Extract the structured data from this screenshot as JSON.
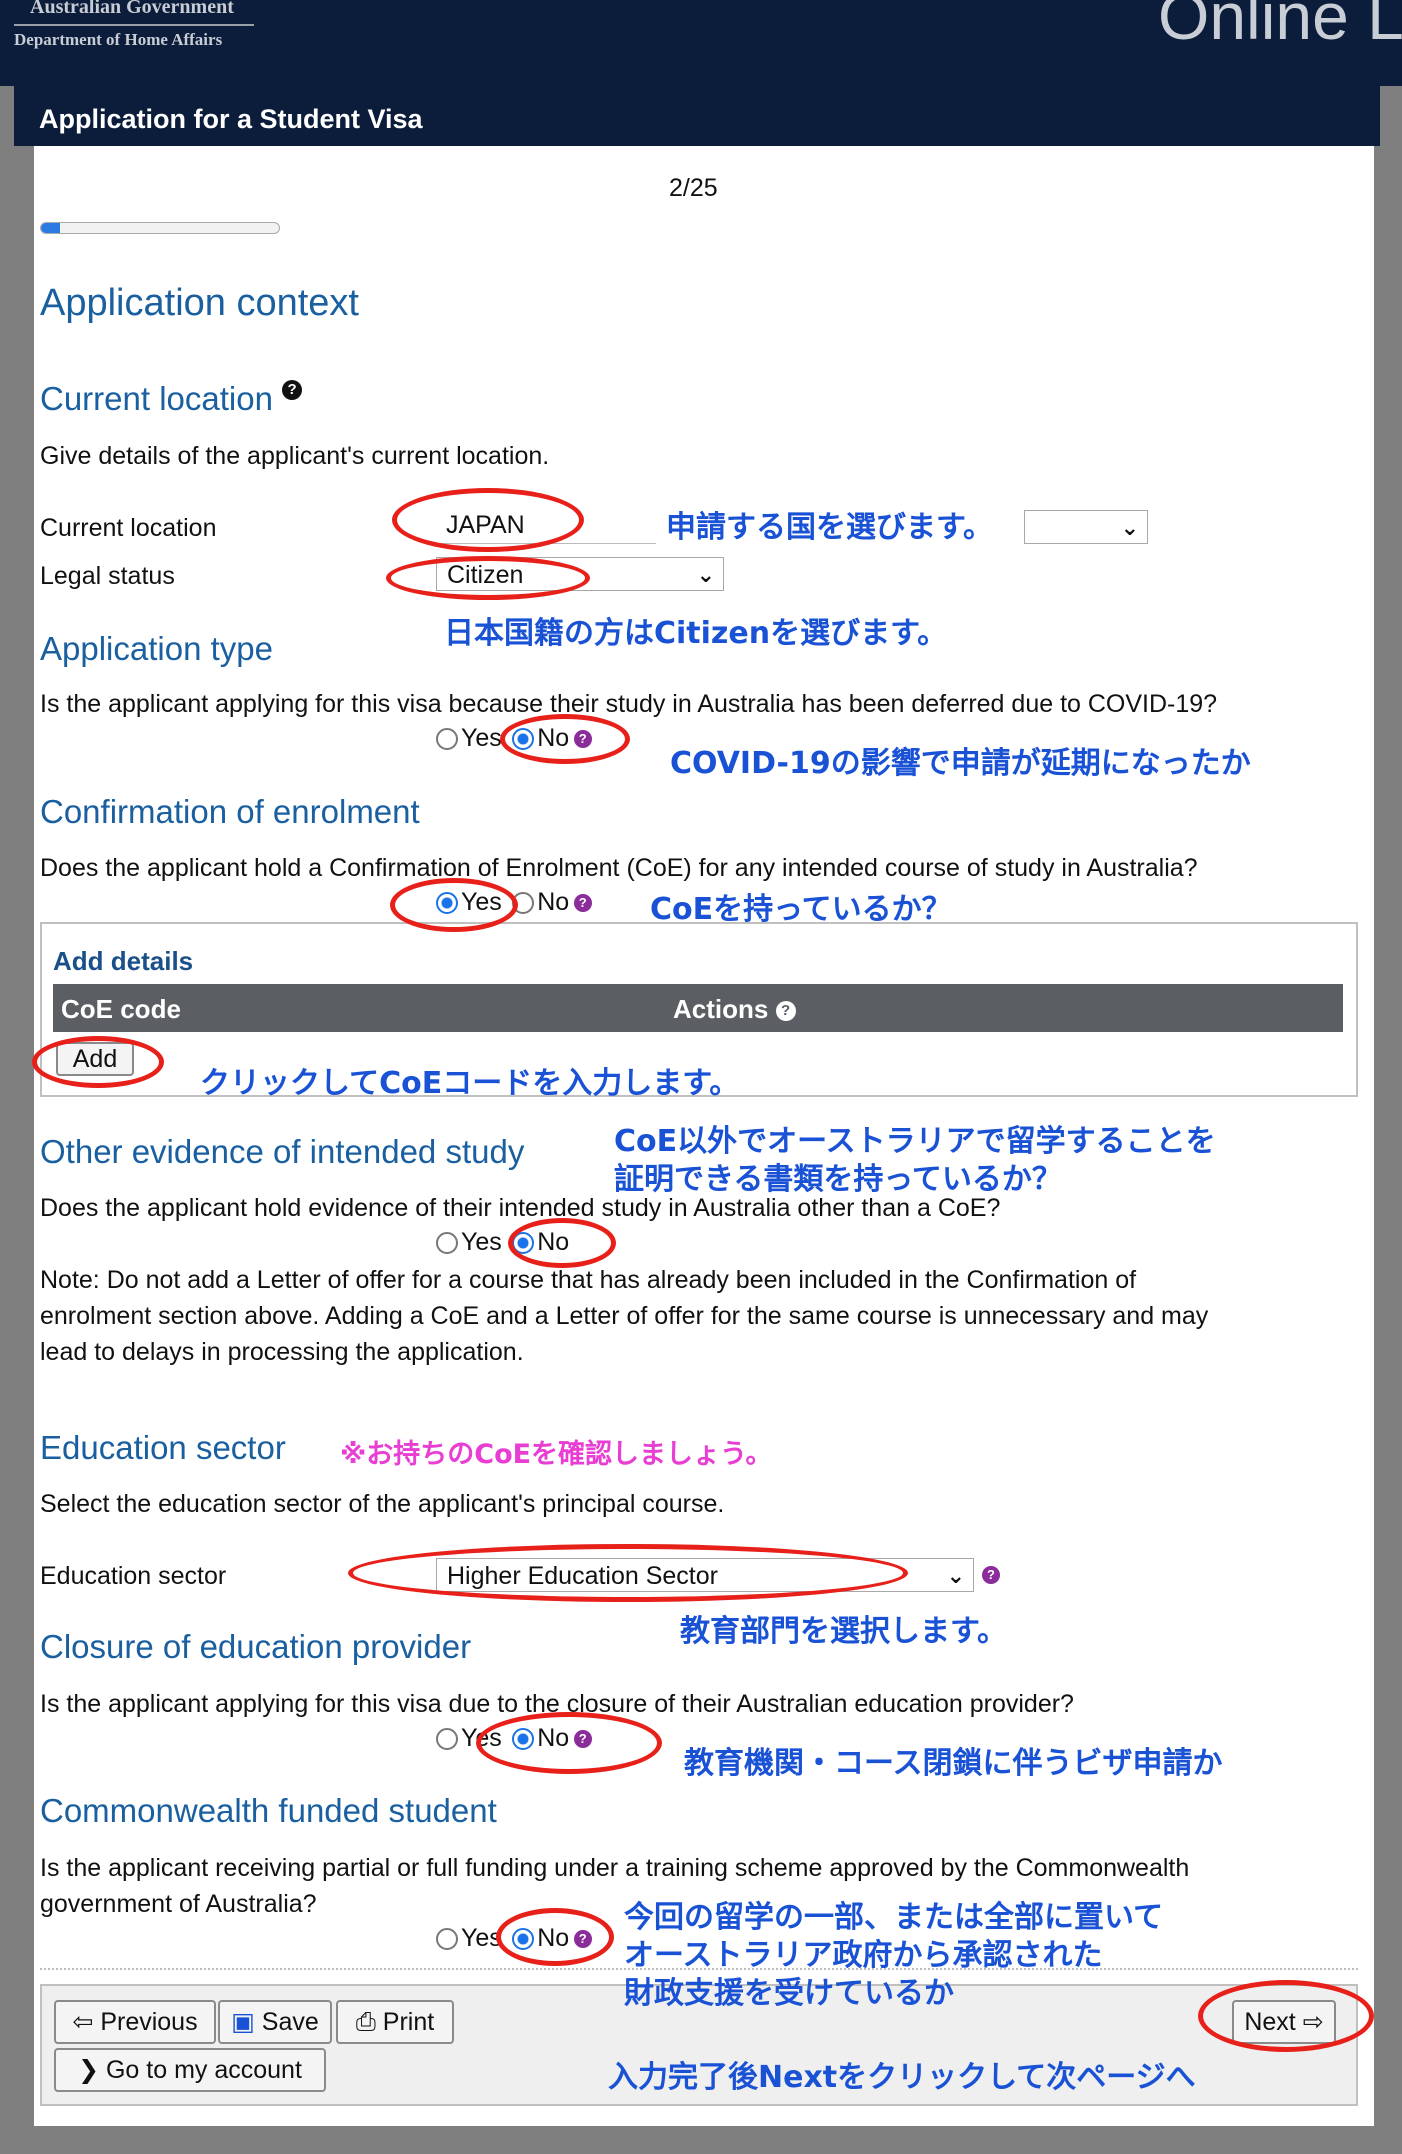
{
  "header": {
    "gov_line1": "Australian Government",
    "gov_line2": "Department of Home Affairs",
    "site_title": "Online L",
    "page_title": "Application for a Student Visa"
  },
  "progress": {
    "page_label": "2/25",
    "fraction": 0.08
  },
  "main_heading": "Application context",
  "sections": {
    "current_location": {
      "heading": "Current location",
      "description": "Give details of the applicant's current location.",
      "location_label": "Current location",
      "location_value": "JAPAN",
      "legal_status_label": "Legal status",
      "legal_status_value": "Citizen"
    },
    "application_type": {
      "heading": "Application type",
      "question": "Is the applicant applying for this visa because their study in Australia has been deferred due to COVID-19?",
      "yes": "Yes",
      "no": "No",
      "selected": "No"
    },
    "coe": {
      "heading": "Confirmation of enrolment",
      "question": "Does the applicant hold a Confirmation of Enrolment (CoE) for any intended course of study in Australia?",
      "yes": "Yes",
      "no": "No",
      "selected": "Yes",
      "add_details": "Add details",
      "col_code": "CoE code",
      "col_actions": "Actions",
      "add_button": "Add"
    },
    "other_evidence": {
      "heading": "Other evidence of intended study",
      "question": "Does the applicant hold evidence of their intended study in Australia other than a CoE?",
      "yes": "Yes",
      "no": "No",
      "selected": "No",
      "note_line1": "Note: Do not add a Letter of offer for a course that has already been included in the Confirmation of",
      "note_line2": "enrolment section above. Adding a CoE and a Letter of offer for the same course is unnecessary and may",
      "note_line3": "lead to delays in processing the application."
    },
    "education_sector": {
      "heading": "Education sector",
      "description": "Select the education sector of the applicant's principal course.",
      "label": "Education sector",
      "value": "Higher Education Sector"
    },
    "closure": {
      "heading": "Closure of education provider",
      "question": "Is the applicant applying for this visa due to the closure of their Australian education provider?",
      "yes": "Yes",
      "no": "No",
      "selected": "No"
    },
    "commonwealth": {
      "heading": "Commonwealth funded student",
      "question_line1": "Is the applicant receiving partial or full funding under a training scheme approved by the Commonwealth",
      "question_line2": "government of Australia?",
      "yes": "Yes",
      "no": "No",
      "selected": "No"
    }
  },
  "footer": {
    "previous": "Previous",
    "save": "Save",
    "print": "Print",
    "account": "Go to my account",
    "next": "Next"
  },
  "annotations": {
    "country": "申請する国を選びます。",
    "citizen": "日本国籍の方はCitizenを選びます。",
    "covid": "COVID-19の影響で申請が延期になったか",
    "coe": "CoEを持っているか？",
    "add": "クリックしてCoEコードを入力します。",
    "evidence_line1": "CoE以外でオーストラリアで留学することを",
    "evidence_line2": "証明できる書類を持っているか？",
    "sector_note": "※お持ちのCoEを確認しましょう。",
    "sector": "教育部門を選択します。",
    "closure": "教育機関・コース閉鎖に伴うビザ申請か",
    "funding_line1": "今回の留学の一部、または全部に置いて",
    "funding_line2": "オーストラリア政府から承認された",
    "funding_line3": "財政支援を受けているか",
    "next": "入力完了後Nextをクリックして次ページへ"
  }
}
